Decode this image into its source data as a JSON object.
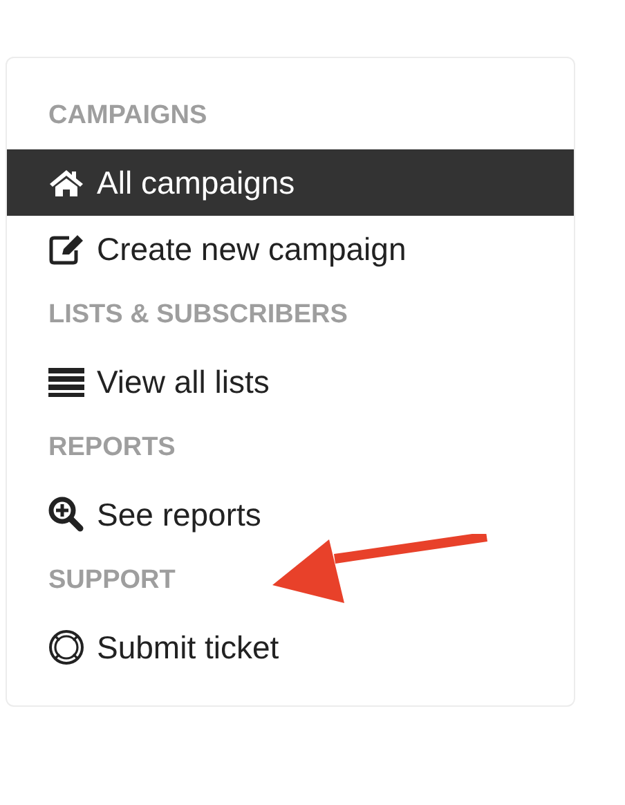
{
  "sections": [
    {
      "heading": "CAMPAIGNS",
      "items": [
        {
          "label": "All campaigns",
          "selected": true
        },
        {
          "label": "Create new campaign",
          "selected": false
        }
      ]
    },
    {
      "heading": "LISTS & SUBSCRIBERS",
      "items": [
        {
          "label": "View all lists",
          "selected": false
        }
      ]
    },
    {
      "heading": "REPORTS",
      "items": [
        {
          "label": "See reports",
          "selected": false
        }
      ]
    },
    {
      "heading": "SUPPORT",
      "items": [
        {
          "label": "Submit ticket",
          "selected": false
        }
      ]
    }
  ]
}
